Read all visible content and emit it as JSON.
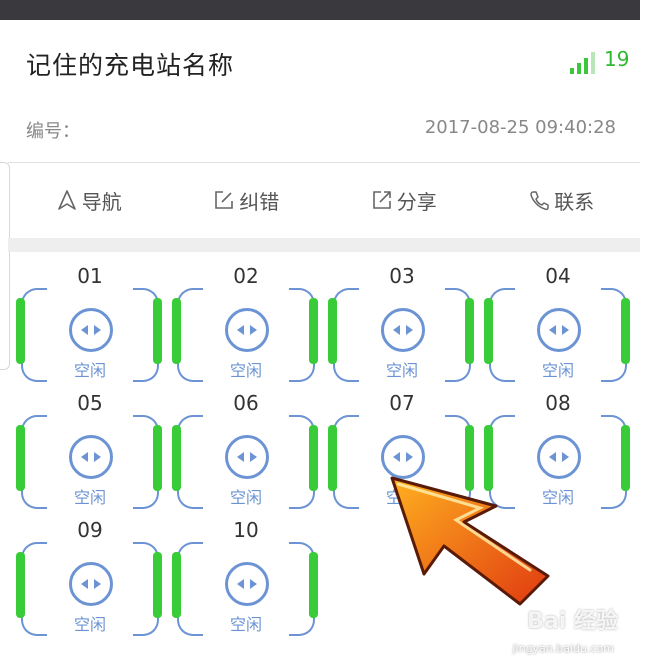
{
  "header": {
    "title": "记住的充电站名称",
    "signal_count": "19",
    "id_label": "编号：",
    "timestamp": "2017-08-25 09:40:28"
  },
  "actions": [
    {
      "label": "导航",
      "icon": "navigate-icon"
    },
    {
      "label": "纠错",
      "icon": "edit-icon"
    },
    {
      "label": "分享",
      "icon": "share-icon"
    },
    {
      "label": "联系",
      "icon": "phone-icon"
    }
  ],
  "ports": [
    {
      "number": "01",
      "status": "空闲"
    },
    {
      "number": "02",
      "status": "空闲"
    },
    {
      "number": "03",
      "status": "空闲"
    },
    {
      "number": "04",
      "status": "空闲"
    },
    {
      "number": "05",
      "status": "空闲"
    },
    {
      "number": "06",
      "status": "空闲"
    },
    {
      "number": "07",
      "status": "空闲"
    },
    {
      "number": "08",
      "status": "空闲"
    },
    {
      "number": "09",
      "status": "空闲"
    },
    {
      "number": "10",
      "status": "空闲"
    }
  ],
  "watermark": {
    "brand": "Bai 经验",
    "url": "jingyan.baidu.com"
  },
  "colors": {
    "accent_blue": "#6c94d4",
    "green": "#39cc39",
    "arrow_orange": "#f07010"
  }
}
